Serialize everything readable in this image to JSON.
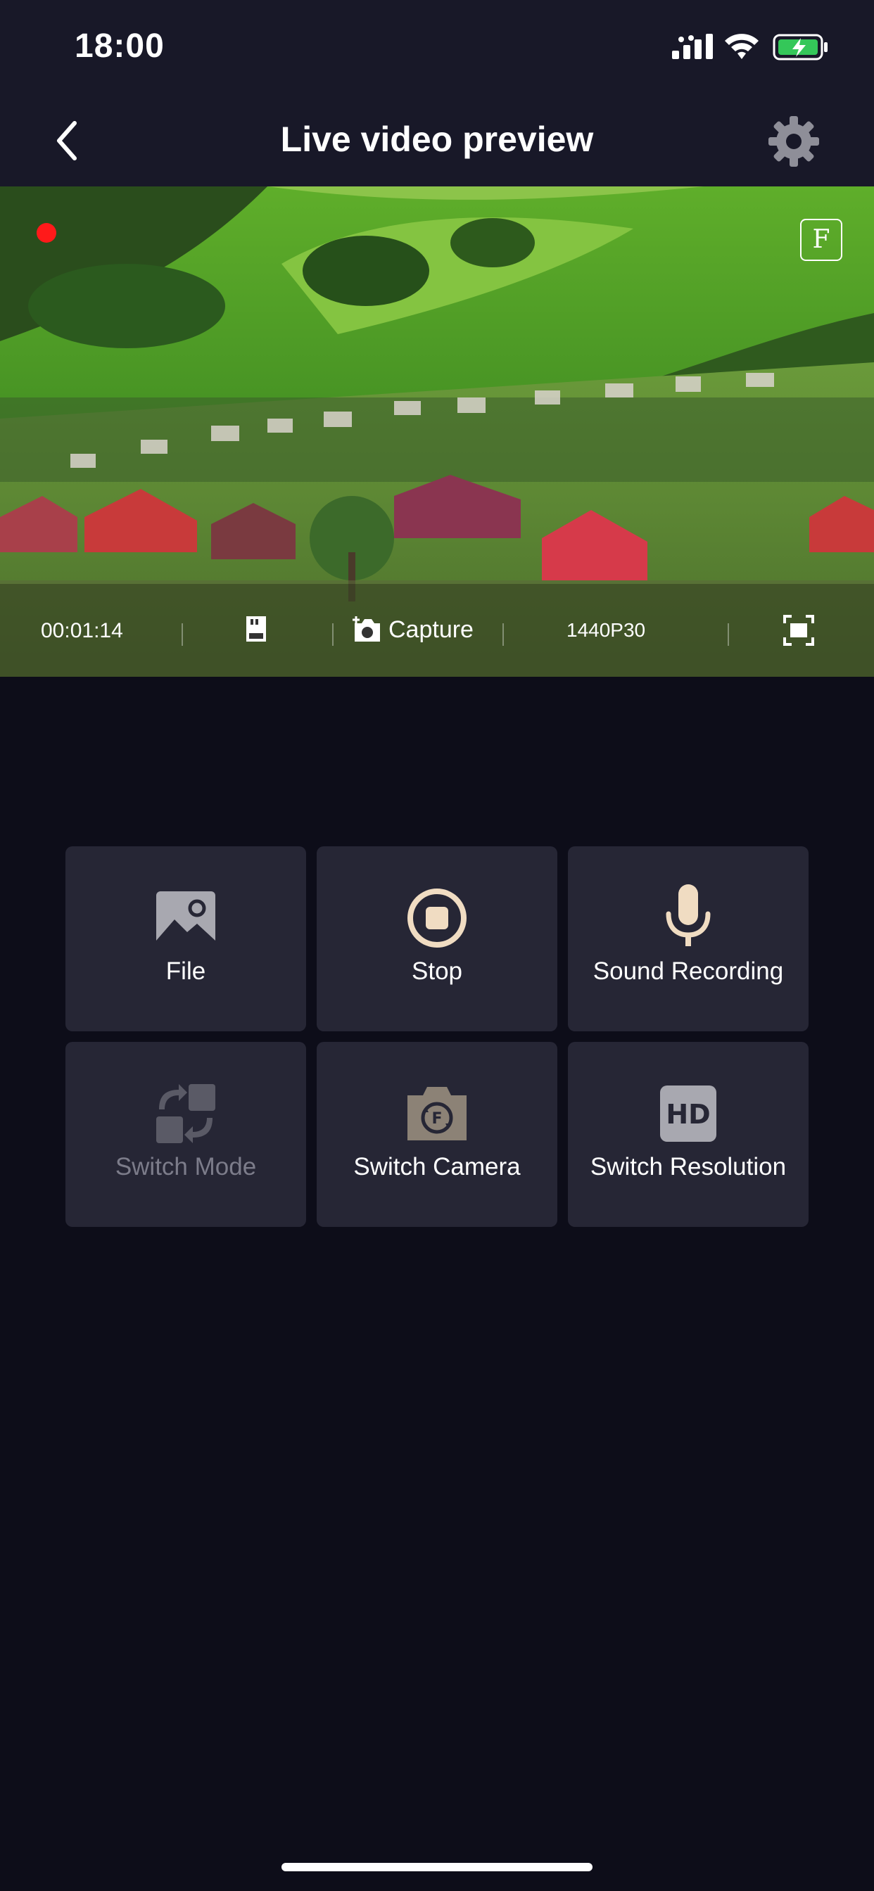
{
  "status_bar": {
    "time": "18:00",
    "icons": [
      "signal-icon",
      "wifi-icon",
      "battery-charging-icon"
    ]
  },
  "nav": {
    "title": "Live video preview",
    "left_icon": "back-icon",
    "right_icon": "gear-icon"
  },
  "video": {
    "recording_indicator_color": "#ff1a1a",
    "badge": "F",
    "toolbar": {
      "elapsed": "00:01:14",
      "sd_icon": "sd-card-icon",
      "capture_label": "Capture",
      "capture_icon": "camera-plus-icon",
      "resolution": "1440P30",
      "fullscreen_icon": "fullscreen-icon"
    }
  },
  "actions": [
    {
      "label": "File",
      "icon": "image-icon",
      "enabled": true
    },
    {
      "label": "Stop",
      "icon": "stop-icon",
      "enabled": true
    },
    {
      "label": "Sound Recording",
      "icon": "microphone-icon",
      "enabled": true
    },
    {
      "label": "Switch Mode",
      "icon": "switch-mode-icon",
      "enabled": false
    },
    {
      "label": "Switch Camera",
      "icon": "switch-camera-icon",
      "enabled": true
    },
    {
      "label": "Switch Resolution",
      "icon": "hd-icon",
      "enabled": true
    }
  ],
  "colors": {
    "background": "#0d0d19",
    "bar": "#181828",
    "tile": "#262635",
    "accent": "#f0dcc2",
    "disabled": "#7c7c8a"
  }
}
